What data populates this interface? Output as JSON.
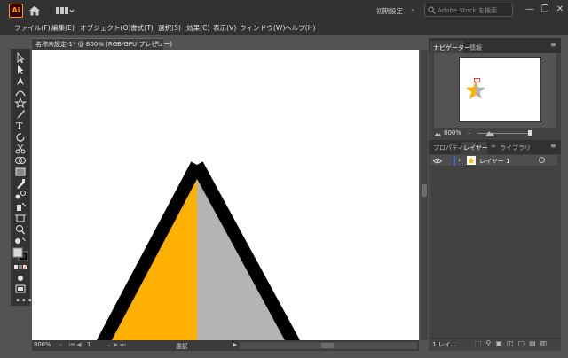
{
  "app": {
    "logo_text": "Ai",
    "workspace_preset": "初期設定",
    "search_placeholder": "Adobe Stock を検索",
    "win_minimize": "—",
    "win_maximize": "❐",
    "win_close": "✕"
  },
  "menu": [
    {
      "label": "ファイル(F)"
    },
    {
      "label": "編集(E)"
    },
    {
      "label": "オブジェクト(O)"
    },
    {
      "label": "書式(T)"
    },
    {
      "label": "選択(S)"
    },
    {
      "label": "効果(C)"
    },
    {
      "label": "表示(V)"
    },
    {
      "label": "ウィンドウ(W)"
    },
    {
      "label": "ヘルプ(H)"
    }
  ],
  "document": {
    "tab_label": "名称未設定-1* @ 800% (RGB/GPU プレビュー)",
    "tab_close": "✕"
  },
  "statusbar": {
    "zoom": "800%",
    "artboard": "1",
    "tool_status": "選択"
  },
  "navigator": {
    "tab_navigator": "ナビゲーター",
    "tab_info": "情報",
    "zoom": "800%"
  },
  "layers": {
    "tab_properties": "プロパティ",
    "tab_layers": "レイヤー",
    "tab_libraries": "ライブラリ",
    "layer_name": "レイヤー 1",
    "footer_count": "1 レイ..."
  },
  "colors": {
    "shape_left": "#ffb000",
    "shape_right": "#b4b4b4",
    "stroke": "#000000",
    "layer_color": "#3d6ee0"
  }
}
